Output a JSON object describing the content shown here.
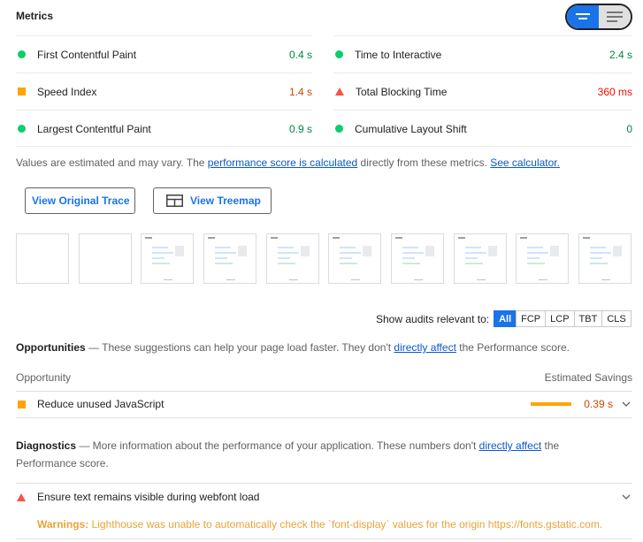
{
  "metrics": {
    "header": "Metrics",
    "items": [
      {
        "title": "First Contentful Paint",
        "value": "0.4 s",
        "rating": "pass"
      },
      {
        "title": "Time to Interactive",
        "value": "2.4 s",
        "rating": "pass"
      },
      {
        "title": "Speed Index",
        "value": "1.4 s",
        "rating": "average"
      },
      {
        "title": "Total Blocking Time",
        "value": "360 ms",
        "rating": "fail"
      },
      {
        "title": "Largest Contentful Paint",
        "value": "0.9 s",
        "rating": "pass"
      },
      {
        "title": "Cumulative Layout Shift",
        "value": "0",
        "rating": "pass"
      }
    ],
    "note_prefix": "Values are estimated and may vary. The ",
    "note_link": "performance score is calculated",
    "note_middle": " directly from these metrics. ",
    "note_link2": "See calculator."
  },
  "buttons": {
    "view_trace": "View Original Trace",
    "view_treemap": "View Treemap"
  },
  "filter": {
    "label": "Show audits relevant to:",
    "chips": [
      "All",
      "FCP",
      "LCP",
      "TBT",
      "CLS"
    ]
  },
  "opportunities": {
    "title": "Opportunities",
    "description": " — These suggestions can help your page load faster. They don't ",
    "link": "directly affect",
    "description_end": " the Performance score.",
    "col_opportunity": "Opportunity",
    "col_savings": "Estimated Savings",
    "items": [
      {
        "title": "Reduce unused JavaScript",
        "savings": "0.39 s"
      }
    ]
  },
  "diagnostics": {
    "title": "Diagnostics",
    "description": " — More information about the performance of your application. These numbers don't ",
    "link": "directly affect",
    "description_end": " the Performance score.",
    "items": [
      {
        "title": "Ensure text remains visible during webfont load"
      }
    ],
    "warning_label": "Warnings:",
    "warning_text": " Lighthouse was unable to automatically check the `font-display` values for the origin https://fonts.gstatic.com."
  },
  "colors": {
    "pass": "#0cce6b",
    "average": "#ffa400",
    "fail": "#ff4e42",
    "accent": "#1a73e8"
  }
}
